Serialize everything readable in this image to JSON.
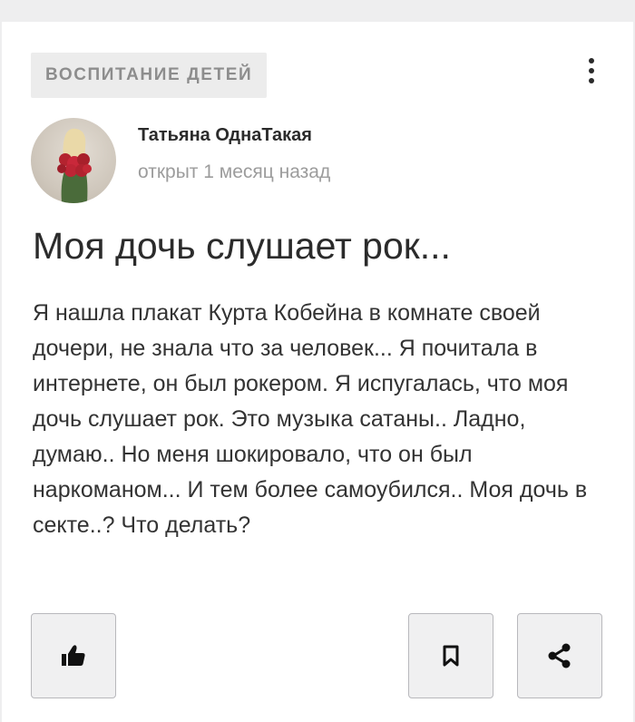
{
  "post": {
    "category": "ВОСПИТАНИЕ ДЕТЕЙ",
    "author_name": "Татьяна ОднаТакая",
    "time_ago": "открыт 1 месяц назад",
    "title": "Моя дочь слушает рок...",
    "body": "Я нашла плакат Курта Кобейна в комнате своей дочери, не знала что за человек... Я почитала в интернете, он был рокером. Я испугалась, что моя дочь слушает рок. Это музыка сатаны.. Ладно, думаю.. Но меня шокировало, что он был наркоманом... И тем более самоубился.. Моя дочь в секте..? Что делать?"
  },
  "actions": {
    "like_icon": "thumbs-up-icon",
    "bookmark_icon": "bookmark-icon",
    "share_icon": "share-icon",
    "menu_icon": "more-vertical-icon"
  },
  "colors": {
    "page_bg": "#eeeeef",
    "card_bg": "#ffffff",
    "category_bg": "#ececec",
    "category_text": "#8d8d8d",
    "button_bg": "#f0f0f1",
    "button_border": "#b8b8bc"
  }
}
